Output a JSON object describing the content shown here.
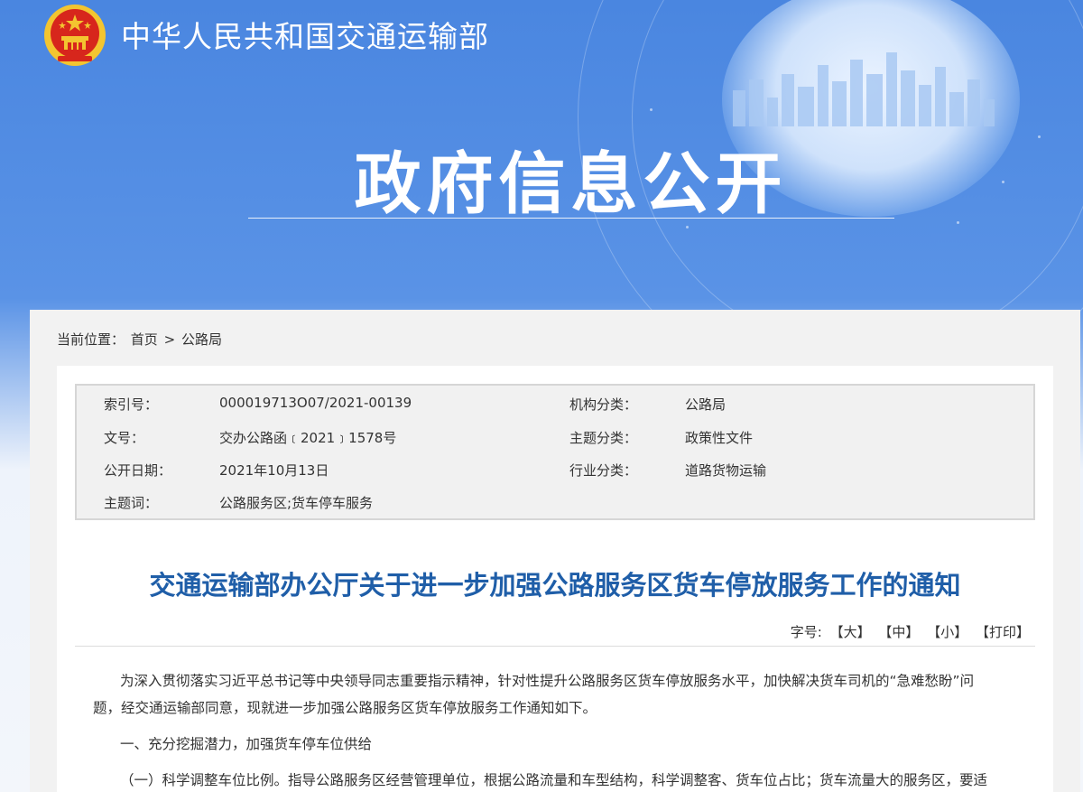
{
  "header": {
    "ministry_name": "中华人民共和国交通运输部",
    "section_title": "政府信息公开"
  },
  "breadcrumb": {
    "prefix": "当前位置：",
    "home": "首页",
    "separator": ">",
    "current": "公路局"
  },
  "meta": {
    "rows": [
      {
        "label1": "索引号：",
        "value1": "000019713O07/2021-00139",
        "label2": "机构分类：",
        "value2": "公路局"
      },
      {
        "label1": "文号：",
        "value1": "交办公路函﹝2021﹞1578号",
        "label2": "主题分类：",
        "value2": "政策性文件"
      },
      {
        "label1": "公开日期：",
        "value1": "2021年10月13日",
        "label2": "行业分类：",
        "value2": "道路货物运输"
      },
      {
        "label1": "主题词：",
        "value1": "公路服务区;货车停车服务",
        "label2": "",
        "value2": ""
      }
    ]
  },
  "document": {
    "title": "交通运输部办公厅关于进一步加强公路服务区货车停放服务工作的通知",
    "font_size_label": "字号:",
    "font_large": "【大】",
    "font_medium": "【中】",
    "font_small": "【小】",
    "print": "【打印】",
    "para1_line1": "为深入贯彻落实习近平总书记等中央领导同志重要指示精神，针对性提升公路服务区货车停放服务水平，加快解决货车司机的“急难愁盼”问",
    "para1_line2": "题，经交通运输部同意，现就进一步加强公路服务区货车停放服务工作通知如下。",
    "para2": "一、充分挖掘潜力，加强货车停车位供给",
    "para3": "（一）科学调整车位比例。指导公路服务区经营管理单位，根据公路流量和车型结构，科学调整客、货车位占比；货车流量大的服务区，要适"
  },
  "colors": {
    "banner": "#4a86e0",
    "title_blue": "#1f5ea8",
    "emblem_red": "#d7261c",
    "emblem_gold": "#f3c530"
  }
}
